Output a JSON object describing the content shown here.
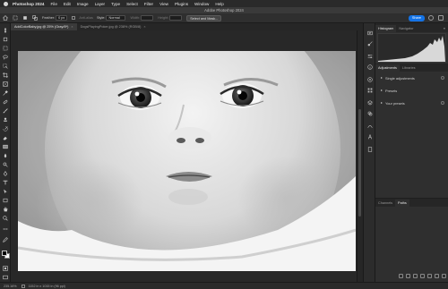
{
  "menubar": {
    "app_name": "Photoshop 2024",
    "items": [
      "File",
      "Edit",
      "Image",
      "Layer",
      "Type",
      "Select",
      "Filter",
      "View",
      "Plugins",
      "Window",
      "Help"
    ]
  },
  "window": {
    "title": "Adobe Photoshop 2024"
  },
  "options_bar": {
    "feather_label": "Feather:",
    "feather_value": "0 px",
    "antialias_label": "Anti-alias",
    "style_label": "Style:",
    "style_value": "Normal",
    "width_label": "Width:",
    "height_label": "Height:",
    "select_mask_label": "Select and Mask...",
    "share_label": "Share"
  },
  "document_tabs": [
    {
      "label": "AddColorBaby.jpg @ 25% (Gray/8*)",
      "active": true
    },
    {
      "label": "DogsPlayingPoker.jpg @ 238% (RGB/8)",
      "active": false
    }
  ],
  "status_bar": {
    "zoom": "235.16%",
    "doc_info": "1152 in x 1015 in (96 ppi)"
  },
  "panels": {
    "top_tabs": [
      "Histogram",
      "Navigator"
    ],
    "adjust_tabs": [
      "Adjustments",
      "Libraries"
    ],
    "adjust_items": [
      "Single adjustments",
      "Presets",
      "Your presets"
    ],
    "bottom_tabs": [
      "Channels",
      "Paths"
    ]
  },
  "colors": {
    "accent": "#1473e6",
    "foreground": "#000000",
    "background": "#ffffff"
  }
}
